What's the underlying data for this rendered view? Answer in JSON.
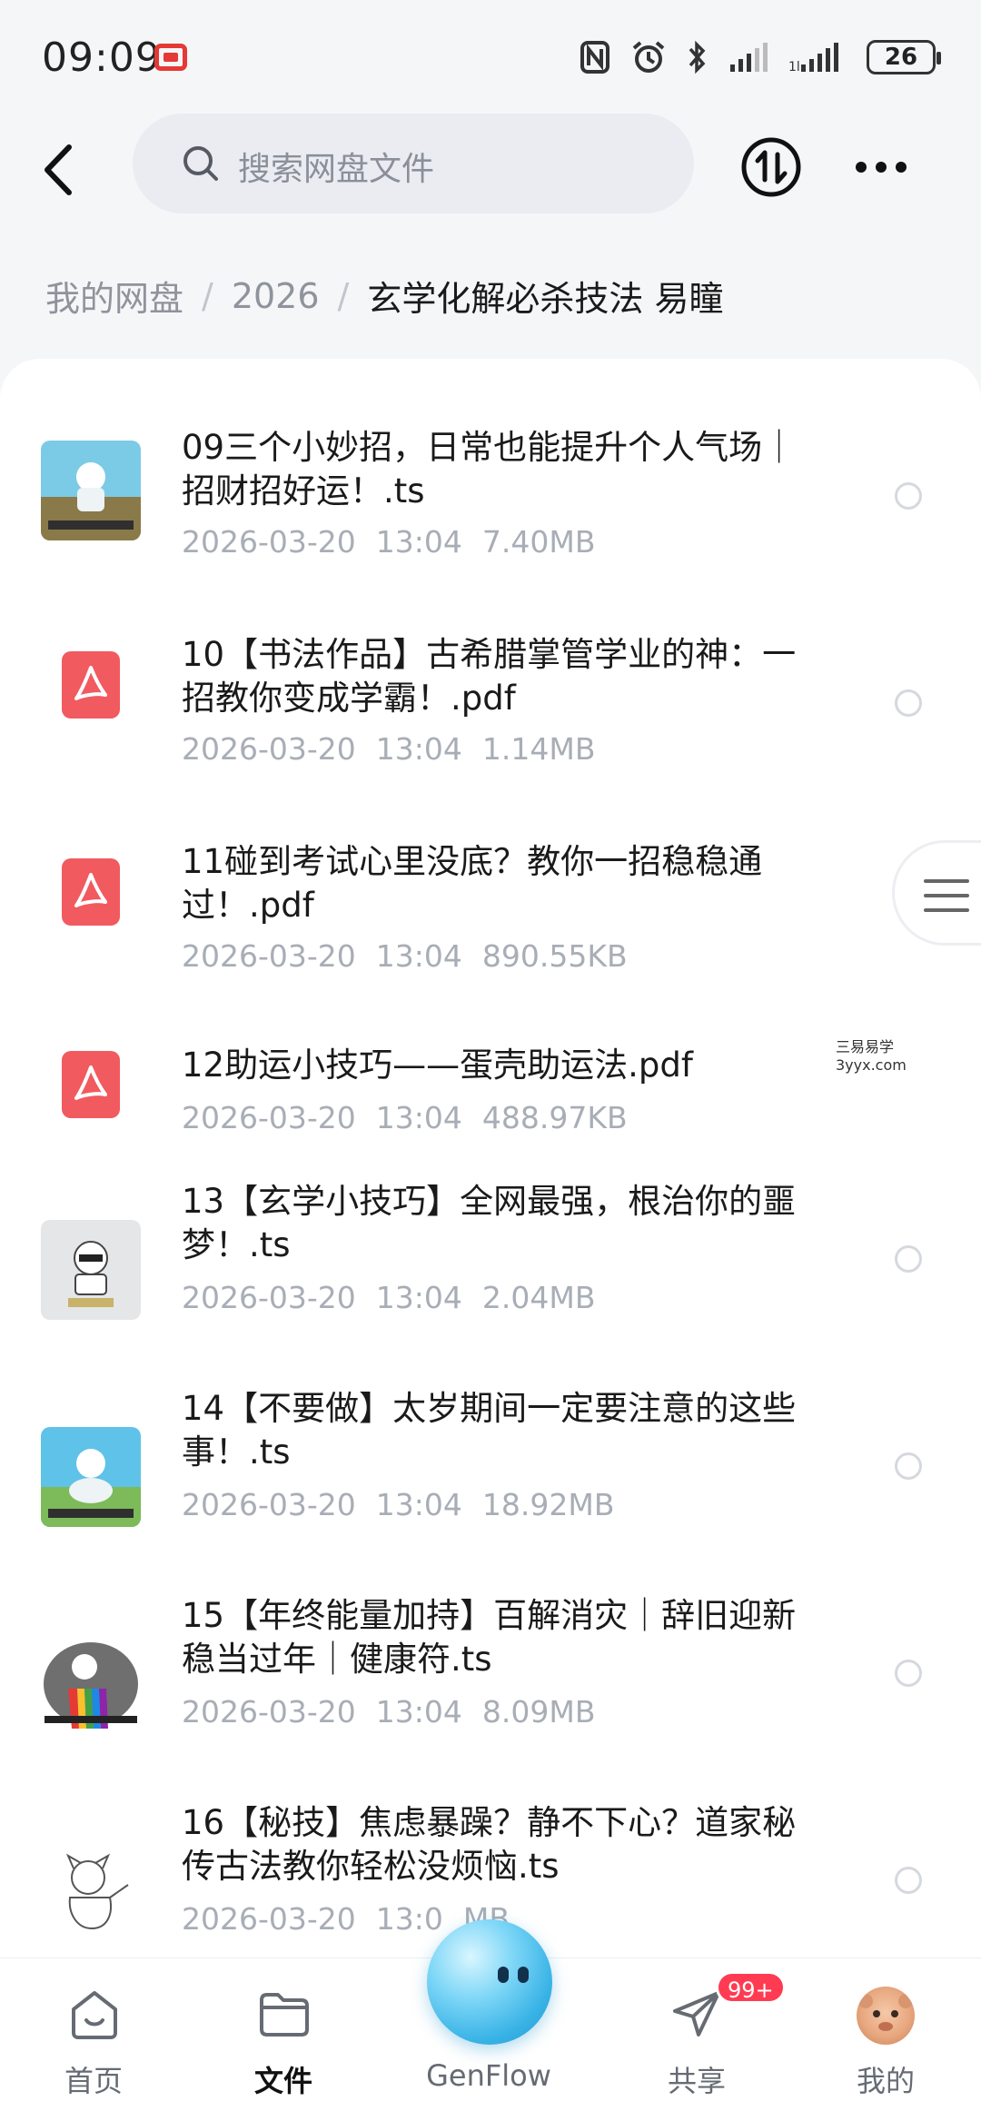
{
  "status_bar": {
    "time": "09:09",
    "battery": "26"
  },
  "header": {
    "search_placeholder": "搜索网盘文件"
  },
  "breadcrumb": {
    "items": [
      "我的网盘",
      "2026"
    ],
    "separator": "/",
    "current": "玄学化解必杀技法 易瞳"
  },
  "files": [
    {
      "name": "09三个小妙招，日常也能提升个人气场｜招财招好运！.ts",
      "date": "2026-03-20",
      "time": "13:04",
      "size": "7.40MB",
      "type": "video"
    },
    {
      "name": "10【书法作品】古希腊掌管学业的神：一招教你变成学霸！.pdf",
      "date": "2026-03-20",
      "time": "13:04",
      "size": "1.14MB",
      "type": "pdf"
    },
    {
      "name": "11碰到考试心里没底？教你一招稳稳通过！.pdf",
      "date": "2026-03-20",
      "time": "13:04",
      "size": "890.55KB",
      "type": "pdf"
    },
    {
      "name": "12助运小技巧——蛋壳助运法.pdf",
      "date": "2026-03-20",
      "time": "13:04",
      "size": "488.97KB",
      "type": "pdf"
    },
    {
      "name": "13【玄学小技巧】全网最强，根治你的噩梦！.ts",
      "date": "2026-03-20",
      "time": "13:04",
      "size": "2.04MB",
      "type": "video"
    },
    {
      "name": "14【不要做】太岁期间一定要注意的这些事！.ts",
      "date": "2026-03-20",
      "time": "13:04",
      "size": "18.92MB",
      "type": "video"
    },
    {
      "name": "15【年终能量加持】百解消灾｜辞旧迎新稳当过年｜健康符.ts",
      "date": "2026-03-20",
      "time": "13:04",
      "size": "8.09MB",
      "type": "video"
    },
    {
      "name": "16【秘技】焦虑暴躁？静不下心？道家秘传古法教你轻松没烦恼.ts",
      "date": "2026-03-20",
      "time": "13:0",
      "size": "MB",
      "type": "video"
    }
  ],
  "watermark": {
    "line1": "三易易学",
    "line2": "3yyx.com"
  },
  "bottom_nav": {
    "items": [
      {
        "label": "首页",
        "icon": "home-icon"
      },
      {
        "label": "文件",
        "icon": "folder-icon"
      },
      {
        "label": "GenFlow",
        "icon": "genflow-orb-icon"
      },
      {
        "label": "共享",
        "icon": "share-icon"
      },
      {
        "label": "我的",
        "icon": "avatar"
      }
    ],
    "active_index": 1,
    "share_badge": "99+"
  },
  "colors": {
    "pdf_red": "#f15a5f",
    "badge_red": "#ff3b52",
    "genflow_blue": "#39b3e6"
  }
}
